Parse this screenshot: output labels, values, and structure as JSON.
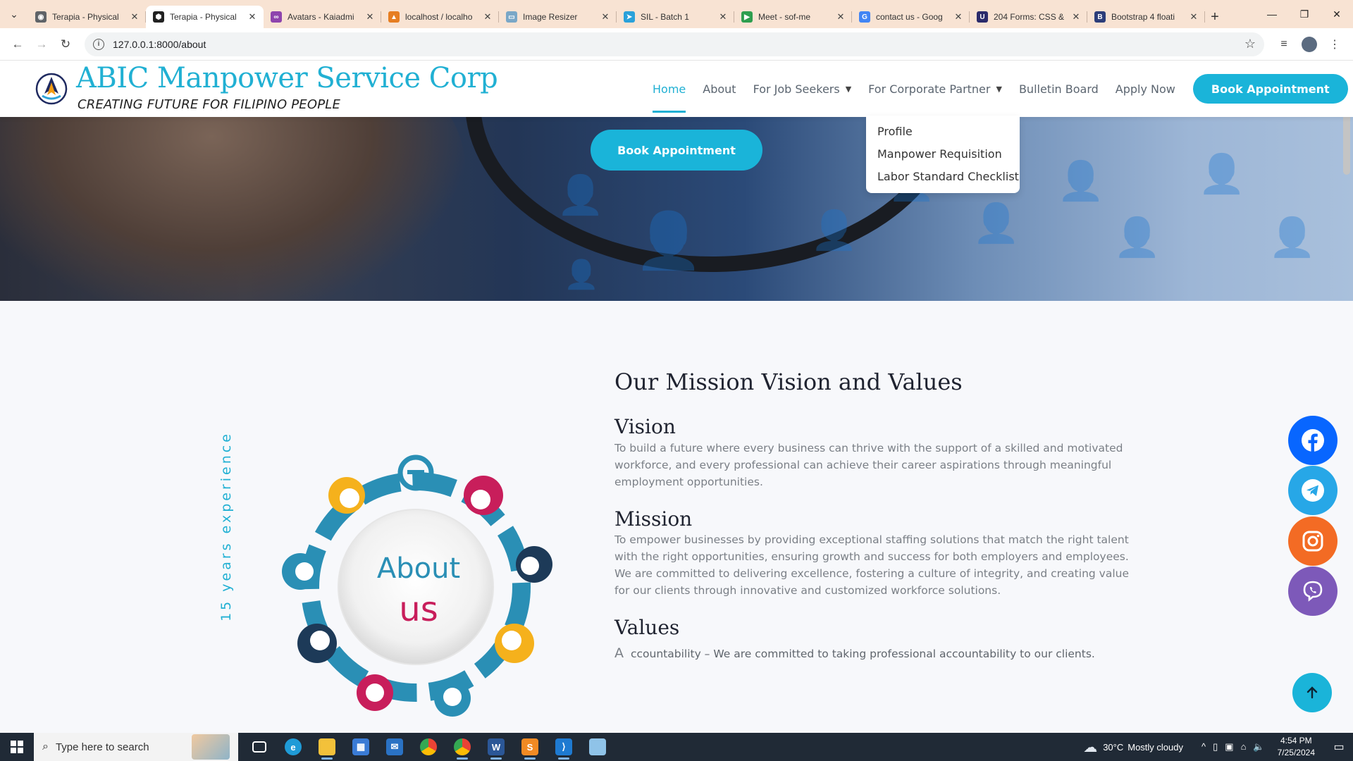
{
  "browser": {
    "tabs": [
      {
        "title": "Terapia - Physical",
        "fav_color": "#5f6368",
        "fav_glyph": "◉",
        "active": false
      },
      {
        "title": "Terapia - Physical",
        "fav_color": "#222222",
        "fav_glyph": "⬢",
        "active": true
      },
      {
        "title": "Avatars - Kaiadmi",
        "fav_color": "#8e44ad",
        "fav_glyph": "∞",
        "active": false
      },
      {
        "title": "localhost / localho",
        "fav_color": "#e67e22",
        "fav_glyph": "▲",
        "active": false
      },
      {
        "title": "Image Resizer",
        "fav_color": "#7aa7c7",
        "fav_glyph": "▭",
        "active": false
      },
      {
        "title": "SIL - Batch 1",
        "fav_color": "#2aa1da",
        "fav_glyph": "➤",
        "active": false
      },
      {
        "title": "Meet - sof-me",
        "fav_color": "#2e9e4f",
        "fav_glyph": "▶",
        "active": false
      },
      {
        "title": "contact us - Goog",
        "fav_color": "#4285f4",
        "fav_glyph": "G",
        "active": false
      },
      {
        "title": "204 Forms: CSS &",
        "fav_color": "#2b2b6b",
        "fav_glyph": "U",
        "active": false
      },
      {
        "title": "Bootstrap 4 floati",
        "fav_color": "#2c3e7a",
        "fav_glyph": "B",
        "active": false
      }
    ],
    "url": "127.0.0.1:8000/about"
  },
  "header": {
    "brand_name": "ABIC Manpower Service Corp",
    "tagline": "CREATING FUTURE FOR FILIPINO PEOPLE",
    "nav": {
      "home": "Home",
      "about": "About",
      "job_seekers": "For Job Seekers",
      "corporate": "For Corporate Partner",
      "bulletin": "Bulletin Board",
      "apply": "Apply Now"
    },
    "cta": "Book Appointment"
  },
  "dropdown": {
    "items": [
      "Profile",
      "Manpower Requisition",
      "Labor Standard Checklist"
    ]
  },
  "hero": {
    "cta": "Book Appointment"
  },
  "about": {
    "experience": "15 years experience",
    "badge_line1": "About",
    "badge_line2": "us"
  },
  "mission": {
    "title": "Our Mission Vision and Values",
    "vision_heading": "Vision",
    "vision_text": "To build a future where every business can thrive with the support of a skilled and motivated workforce, and every professional can achieve their career aspirations through meaningful employment opportunities.",
    "mission_heading": "Mission",
    "mission_text": "To empower businesses by providing exceptional staffing solutions that match the right talent with the right opportunities, ensuring growth and success for both employers and employees. We are committed to delivering excellence, fostering a culture of integrity, and creating value for our clients through innovative and customized workforce solutions.",
    "values_heading": "Values",
    "values_first_letter": "A",
    "values_first_text": "ccountability – We are committed to taking professional accountability to our clients."
  },
  "social": {
    "facebook_color": "#0866ff",
    "telegram_color": "#27a7e7",
    "instagram_color": "#f36b24",
    "viber_color": "#7d59b9"
  },
  "taskbar": {
    "search_placeholder": "Type here to search",
    "weather_temp": "30°C",
    "weather_desc": "Mostly cloudy",
    "time": "4:54 PM",
    "date": "7/25/2024"
  }
}
